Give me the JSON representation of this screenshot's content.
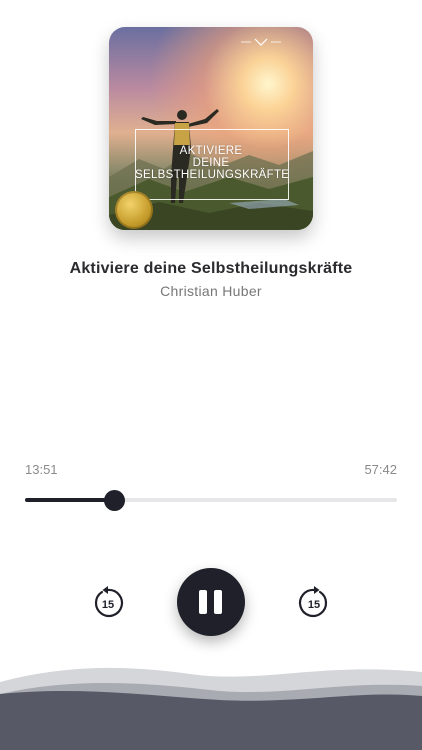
{
  "cover": {
    "text_lines": [
      "AKTIVIERE",
      "DEINE",
      "SELBSTHEILUNGSKRÄFTE"
    ]
  },
  "track": {
    "title": "Aktiviere deine Selbstheilungskräfte",
    "author": "Christian Huber"
  },
  "progress": {
    "elapsed": "13:51",
    "total": "57:42",
    "fraction": 0.24
  },
  "controls": {
    "rewind_seconds": "15",
    "forward_seconds": "15",
    "state": "playing"
  },
  "colors": {
    "accent": "#1f2029",
    "track_bg": "#e6e6e8",
    "wave_front": "#575a66"
  }
}
